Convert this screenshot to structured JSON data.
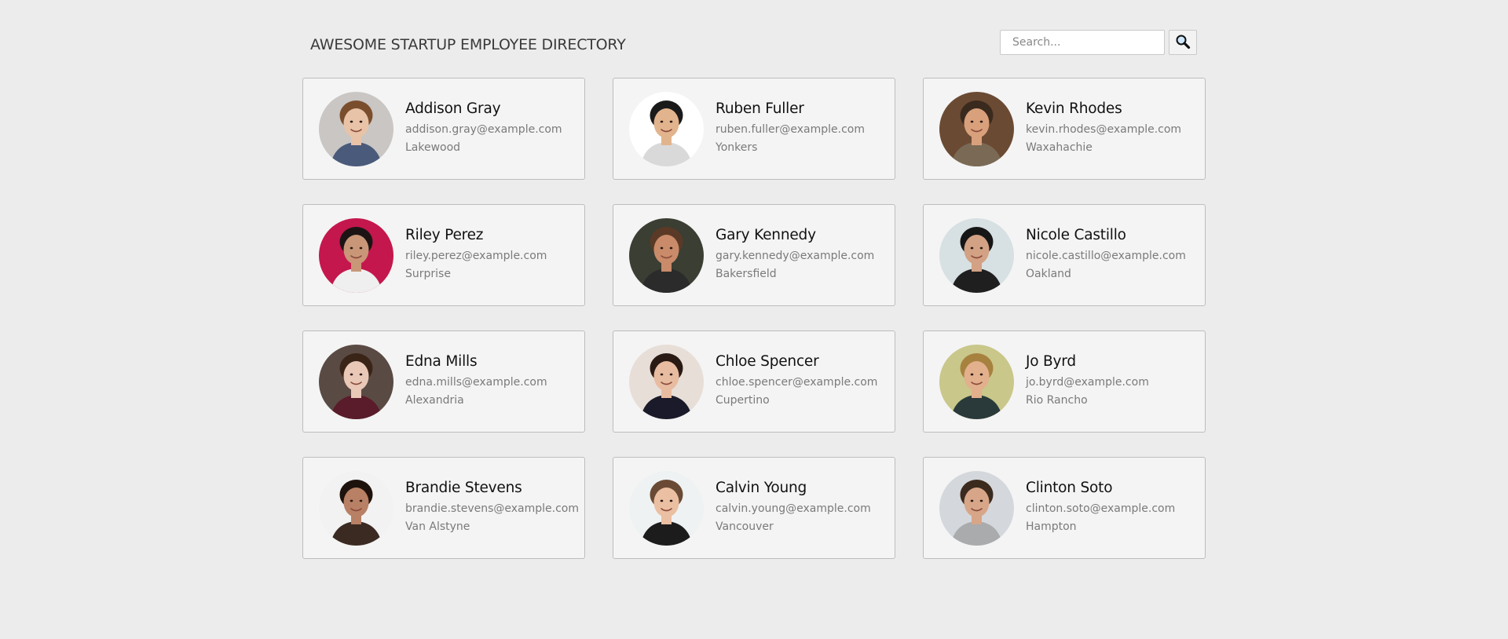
{
  "header": {
    "title": "AWESOME STARTUP EMPLOYEE DIRECTORY"
  },
  "search": {
    "placeholder": "Search...",
    "button_icon": "search-icon"
  },
  "colors": {
    "background": "#ececec",
    "card": "#f4f4f4",
    "card_border": "#bdbdbd"
  },
  "employees": [
    {
      "name": "Addison Gray",
      "email": "addison.gray@example.com",
      "city": "Lakewood",
      "avatar_icon": "person-photo",
      "skin": "#e8c3a8",
      "hair": "#7a4e2d",
      "bg": "#c9c6c4",
      "shirt": "#4a5a7a"
    },
    {
      "name": "Ruben Fuller",
      "email": "ruben.fuller@example.com",
      "city": "Yonkers",
      "avatar_icon": "person-photo",
      "skin": "#e2b48d",
      "hair": "#1a1a1a",
      "bg": "#ffffff",
      "shirt": "#d9d9d9"
    },
    {
      "name": "Kevin Rhodes",
      "email": "kevin.rhodes@example.com",
      "city": "Waxahachie",
      "avatar_icon": "person-photo",
      "skin": "#d9a07c",
      "hair": "#3a2a1e",
      "bg": "#6b4a33",
      "shirt": "#7a6a55"
    },
    {
      "name": "Riley Perez",
      "email": "riley.perez@example.com",
      "city": "Surprise",
      "avatar_icon": "person-photo",
      "skin": "#c99678",
      "hair": "#1c1414",
      "bg": "#c4174d",
      "shirt": "#efefef"
    },
    {
      "name": "Gary Kennedy",
      "email": "gary.kennedy@example.com",
      "city": "Bakersfield",
      "avatar_icon": "person-photo",
      "skin": "#c98b6a",
      "hair": "#5a3a26",
      "bg": "#3a3e33",
      "shirt": "#2b2b2b"
    },
    {
      "name": "Nicole Castillo",
      "email": "nicole.castillo@example.com",
      "city": "Oakland",
      "avatar_icon": "person-photo",
      "skin": "#d3a184",
      "hair": "#161616",
      "bg": "#d7e0e2",
      "shirt": "#1f1f1f"
    },
    {
      "name": "Edna Mills",
      "email": "edna.mills@example.com",
      "city": "Alexandria",
      "avatar_icon": "person-photo",
      "skin": "#e9c8b7",
      "hair": "#3a2418",
      "bg": "#5a4a44",
      "shirt": "#5a1c2a"
    },
    {
      "name": "Chloe Spencer",
      "email": "chloe.spencer@example.com",
      "city": "Cupertino",
      "avatar_icon": "person-photo",
      "skin": "#e8bca0",
      "hair": "#2a1a14",
      "bg": "#e7ded8",
      "shirt": "#1a1a2a"
    },
    {
      "name": "Jo Byrd",
      "email": "jo.byrd@example.com",
      "city": "Rio Rancho",
      "avatar_icon": "person-photo",
      "skin": "#e2b08c",
      "hair": "#a7813e",
      "bg": "#c9c78a",
      "shirt": "#2a3a3a"
    },
    {
      "name": "Brandie Stevens",
      "email": "brandie.stevens@example.com",
      "city": "Van Alstyne",
      "avatar_icon": "person-photo",
      "skin": "#b88064",
      "hair": "#1e120c",
      "bg": "#f2f2f2",
      "shirt": "#3a2a22"
    },
    {
      "name": "Calvin Young",
      "email": "calvin.young@example.com",
      "city": "Vancouver",
      "avatar_icon": "person-photo",
      "skin": "#ebbfa2",
      "hair": "#6a4a34",
      "bg": "#eef2f3",
      "shirt": "#1c1c1c"
    },
    {
      "name": "Clinton Soto",
      "email": "clinton.soto@example.com",
      "city": "Hampton",
      "avatar_icon": "person-photo",
      "skin": "#d7a688",
      "hair": "#3b2a1e",
      "bg": "#d4d8dc",
      "shirt": "#a9abad"
    }
  ]
}
